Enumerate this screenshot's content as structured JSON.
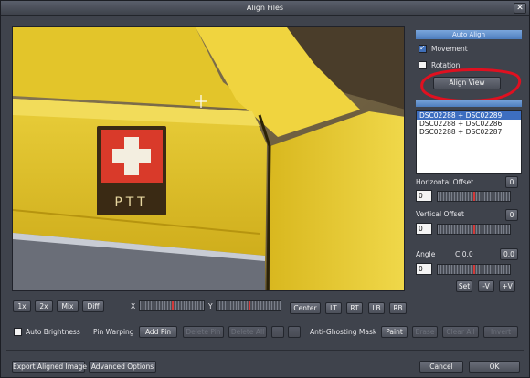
{
  "window": {
    "title": "Align Files",
    "close_glyph": "✕"
  },
  "auto_align": {
    "header": "Auto Align",
    "movement_label": "Movement",
    "movement_checked": true,
    "rotation_label": "Rotation",
    "rotation_checked": false,
    "align_view_label": "Align View"
  },
  "pairs": {
    "items": [
      "DSC02288 + DSC02289",
      "DSC02288 + DSC02286",
      "DSC02288 + DSC02287"
    ],
    "selected_index": 0
  },
  "horizontal_offset": {
    "label": "Horizontal Offset",
    "value": "0",
    "reset_label": "0"
  },
  "vertical_offset": {
    "label": "Vertical Offset",
    "value": "0",
    "reset_label": "0"
  },
  "angle": {
    "label": "Angle",
    "readout": "C:0.0",
    "value": "0",
    "reset_label": "0.0",
    "set_label": "Set",
    "minus_label": "-V",
    "plus_label": "+V"
  },
  "zoom_buttons": [
    "1x",
    "2x",
    "Mix",
    "Diff"
  ],
  "x_label": "X",
  "y_label": "Y",
  "position_buttons": [
    "Center",
    "LT",
    "RT",
    "LB",
    "RB"
  ],
  "auto_brightness_label": "Auto Brightness",
  "pin_warping": {
    "label": "Pin Warping",
    "add_pin_label": "Add Pin",
    "remove_pin_label": "Delete Pin",
    "delete_all_label": "Delete All"
  },
  "anti_ghosting": {
    "label": "Anti-Ghosting Mask",
    "paint_label": "Paint",
    "erase_label": "Erase",
    "clear_label": "Clear All",
    "invert_label": "Invert"
  },
  "footer": {
    "export_label": "Export Aligned Image",
    "advanced_label": "Advanced Options",
    "cancel_label": "Cancel",
    "ok_label": "OK"
  },
  "photo": {
    "sign_text": "PTT"
  },
  "colors": {
    "accent": "#4d7dbd",
    "annotation": "#e01020",
    "car_yellow": "#e2c21e"
  }
}
